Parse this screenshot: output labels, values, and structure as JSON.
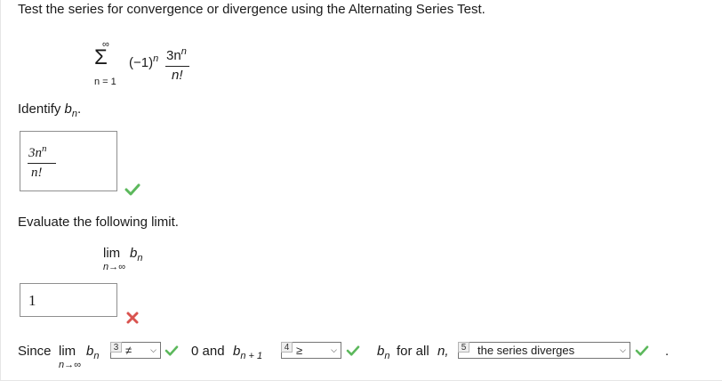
{
  "question": {
    "prompt": "Test the series for convergence or divergence using the Alternating Series Test.",
    "series": {
      "sigma": "Σ",
      "upper": "∞",
      "lower": "n = 1",
      "sign_term": "(−1)",
      "sign_exp": "n",
      "num_base": "3n",
      "num_exp": "n",
      "denominator": "n!"
    }
  },
  "part1": {
    "label_prefix": "Identify ",
    "label_var": "b",
    "label_sub": "n",
    "label_suffix": ".",
    "answer": {
      "num_base": "3n",
      "num_exp": "n",
      "denominator": "n!"
    },
    "status": "correct"
  },
  "part2": {
    "label": "Evaluate the following limit.",
    "limit": {
      "word": "lim",
      "var": "b",
      "sub": "n",
      "under": "n→∞"
    },
    "answer": "1",
    "status": "incorrect"
  },
  "part3": {
    "since": "Since",
    "lim": "lim",
    "under": "n→∞",
    "var": "b",
    "sub": "n",
    "select3": {
      "number": "3",
      "value": "≠"
    },
    "text_0_and": "0 and",
    "var2": "b",
    "sub2": "n + 1",
    "select4": {
      "number": "4",
      "value": "≥"
    },
    "var3": "b",
    "sub3": "n",
    "for_all": "for all",
    "n": "n,",
    "select5": {
      "number": "5",
      "value": "the series diverges"
    },
    "period": "."
  },
  "colors": {
    "check": "#5cb85c",
    "cross": "#d9534f"
  },
  "icons": {
    "correct": "check-icon",
    "incorrect": "cross-icon",
    "dropdown": "chevron-down-icon"
  }
}
